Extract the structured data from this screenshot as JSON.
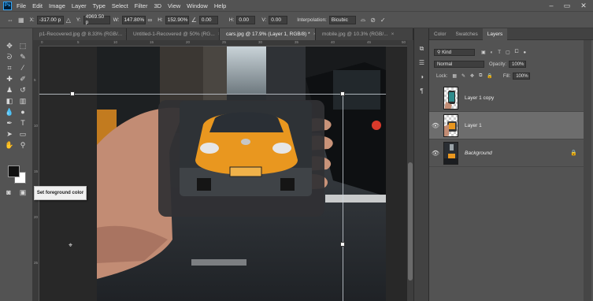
{
  "menubar": {
    "logo": "Ps",
    "items": [
      "File",
      "Edit",
      "Image",
      "Layer",
      "Type",
      "Select",
      "Filter",
      "3D",
      "View",
      "Window",
      "Help"
    ]
  },
  "options": {
    "x_label": "X:",
    "x_value": "-317.00 p",
    "y_label": "Y:",
    "y_value": "4969.50 p",
    "w_label": "W:",
    "w_value": "147.80%",
    "h_label": "H:",
    "h_value": "152.90%",
    "angle_value": "0.00",
    "hskew_label": "H:",
    "hskew_value": "0.00",
    "vskew_label": "V:",
    "vskew_value": "0.00",
    "interp_label": "Interpolation:",
    "interp_value": "Bicubic"
  },
  "tabs": [
    {
      "label": "p1-Recovered.jpg @ 8.33% (RGB/...",
      "active": false
    },
    {
      "label": "Untitled-1-Recovered @ 50% (RG...",
      "active": false
    },
    {
      "label": "cars.jpg @ 17.9% (Layer 1, RGB/8) *",
      "active": true
    },
    {
      "label": "mobile.jpg @ 10.3% (RGB/...",
      "active": false
    }
  ],
  "tab_close": "×",
  "rulers": {
    "h": [
      "0",
      "5",
      "10",
      "15",
      "20",
      "25",
      "30",
      "35",
      "40",
      "45",
      "50"
    ],
    "v": [
      "5",
      "10",
      "15",
      "20",
      "25"
    ]
  },
  "tooltip": "Set foreground color",
  "panel": {
    "tabs": [
      "Color",
      "Swatches",
      "Layers"
    ],
    "kind_placeholder": "Kind",
    "blend_mode": "Normal",
    "opacity_label": "Opacity:",
    "opacity_value": "100%",
    "lock_label": "Lock:",
    "fill_label": "Fill:",
    "fill_value": "100%",
    "layers": [
      {
        "name": "Layer 1 copy",
        "visible": false,
        "selected": false,
        "italic": false
      },
      {
        "name": "Layer 1",
        "visible": true,
        "selected": true,
        "italic": false
      },
      {
        "name": "Background",
        "visible": true,
        "selected": false,
        "italic": true,
        "locked": true
      }
    ]
  },
  "colors": {
    "accent": "#31a8ff",
    "taxi": "#e9971f",
    "foreground": "#111111",
    "background": "#ffffff"
  }
}
